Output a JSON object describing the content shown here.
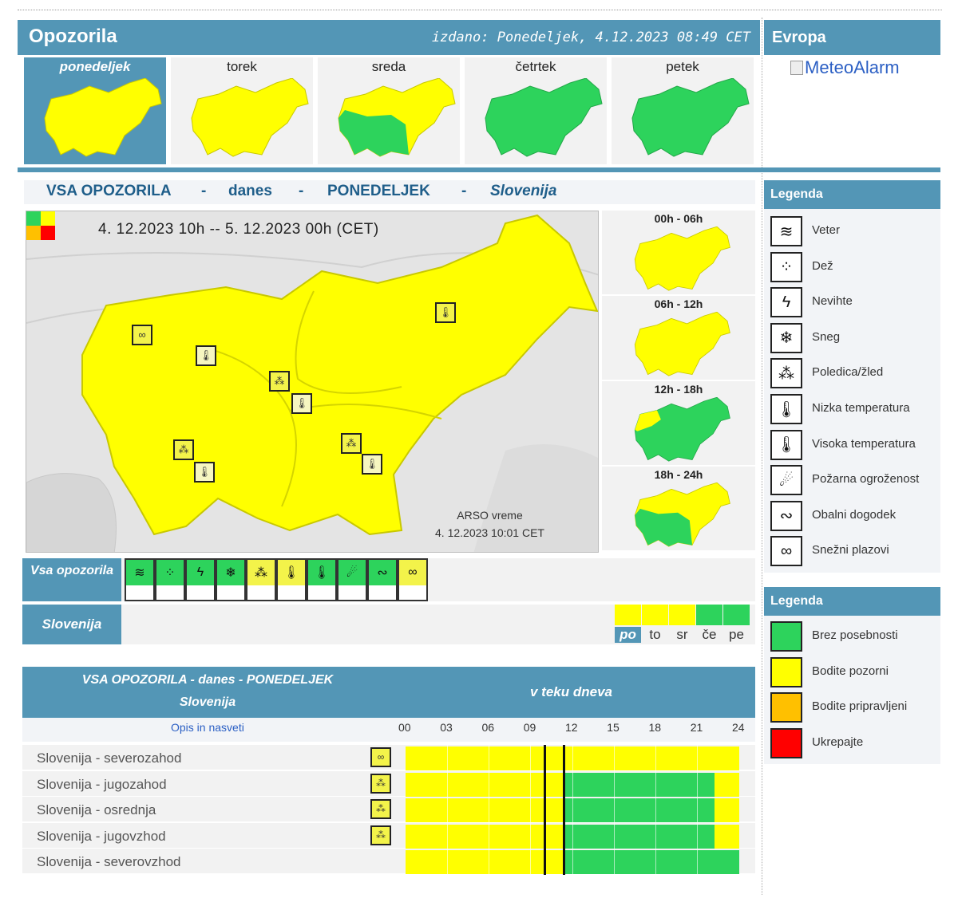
{
  "header": {
    "title": "Opozorila",
    "issued": "izdano: Ponedeljek, 4.12.2023 08:49 CET"
  },
  "europe": {
    "title": "Evropa",
    "meteoalarm_alt": "MeteoAlarm"
  },
  "days": [
    {
      "label": "ponedeljek",
      "active": true,
      "level": "yellow"
    },
    {
      "label": "torek",
      "active": false,
      "level": "yellow"
    },
    {
      "label": "sreda",
      "active": false,
      "level": "mixed"
    },
    {
      "label": "četrtek",
      "active": false,
      "level": "green"
    },
    {
      "label": "petek",
      "active": false,
      "level": "green"
    }
  ],
  "main_heading": {
    "part1": "VSA OPOZORILA",
    "sep1": "-",
    "part2": "danes",
    "sep2": "-",
    "part3": "PONEDELJEK",
    "sep3": "-",
    "part4": "Slovenija"
  },
  "map": {
    "date_range": "4. 12.2023  10h  --  5. 12.2023  00h     (CET)",
    "source": "ARSO vreme",
    "source_time": "4. 12.2023  10:01 CET"
  },
  "periods": [
    {
      "label": "00h - 06h",
      "level": "yellow"
    },
    {
      "label": "06h - 12h",
      "level": "yellow"
    },
    {
      "label": "12h - 18h",
      "level": "mostly-green"
    },
    {
      "label": "18h - 24h",
      "level": "mixed"
    }
  ],
  "categories_label": "Vsa opozorila",
  "categories": [
    {
      "icon": "wind-icon",
      "glyph": "≋",
      "color": "#2dd35c"
    },
    {
      "icon": "rain-icon",
      "glyph": "⁘",
      "color": "#2dd35c"
    },
    {
      "icon": "thunderstorm-icon",
      "glyph": "ϟ",
      "color": "#2dd35c"
    },
    {
      "icon": "snow-icon",
      "glyph": "❄",
      "color": "#2dd35c"
    },
    {
      "icon": "ice-icon",
      "glyph": "⁂",
      "color": "#f3f34a"
    },
    {
      "icon": "low-temperature-icon",
      "glyph": "🌡",
      "color": "#f3f34a"
    },
    {
      "icon": "high-temperature-icon",
      "glyph": "🌡",
      "color": "#2dd35c"
    },
    {
      "icon": "fire-danger-icon",
      "glyph": "☄",
      "color": "#2dd35c"
    },
    {
      "icon": "coastal-event-icon",
      "glyph": "∾",
      "color": "#2dd35c"
    },
    {
      "icon": "avalanche-icon",
      "glyph": "∞",
      "color": "#f3f34a"
    }
  ],
  "region_label": "Slovenija",
  "week": [
    {
      "label": "po",
      "color": "#ffff00",
      "active": true
    },
    {
      "label": "to",
      "color": "#ffff00",
      "active": false
    },
    {
      "label": "sr",
      "color": "#ffff00",
      "active": false
    },
    {
      "label": "če",
      "color": "#2dd35c",
      "active": false
    },
    {
      "label": "pe",
      "color": "#2dd35c",
      "active": false
    }
  ],
  "timeline": {
    "title1": "VSA OPOZORILA - danes - PONEDELJEK",
    "title2": "Slovenija",
    "title3": "v teku dneva",
    "opis": "Opis in nasveti",
    "hours": [
      "00",
      "03",
      "06",
      "09",
      "12",
      "15",
      "18",
      "21",
      "24"
    ],
    "rows": [
      {
        "name": "Slovenija - severozahod",
        "icon": "avalanche-icon",
        "glyph": "∞",
        "green_from": null,
        "green_to": null
      },
      {
        "name": "Slovenija - jugozahod",
        "icon": "ice-icon",
        "glyph": "⁂",
        "green_from": 11.5,
        "green_to": 22.2
      },
      {
        "name": "Slovenija - osrednja",
        "icon": "ice-icon",
        "glyph": "⁂",
        "green_from": 11.5,
        "green_to": 22.2
      },
      {
        "name": "Slovenija - jugovzhod",
        "icon": "ice-icon",
        "glyph": "⁂",
        "green_from": 11.5,
        "green_to": 22.2
      },
      {
        "name": "Slovenija - severovzhod",
        "icon": null,
        "glyph": "",
        "green_from": 11.5,
        "green_to": 24
      }
    ],
    "markers": [
      10,
      11.4
    ]
  },
  "legend1": {
    "title": "Legenda",
    "items": [
      {
        "icon": "wind-icon",
        "glyph": "≋",
        "label": "Veter"
      },
      {
        "icon": "rain-icon",
        "glyph": "⁘",
        "label": "Dež"
      },
      {
        "icon": "thunderstorm-icon",
        "glyph": "ϟ",
        "label": "Nevihte"
      },
      {
        "icon": "snow-icon",
        "glyph": "❄",
        "label": "Sneg"
      },
      {
        "icon": "ice-icon",
        "glyph": "⁂",
        "label": "Poledica/žled"
      },
      {
        "icon": "low-temperature-icon",
        "glyph": "🌡",
        "label": "Nizka temperatura"
      },
      {
        "icon": "high-temperature-icon",
        "glyph": "🌡",
        "label": "Visoka temperatura"
      },
      {
        "icon": "fire-danger-icon",
        "glyph": "☄",
        "label": "Požarna ogroženost"
      },
      {
        "icon": "coastal-event-icon",
        "glyph": "∾",
        "label": "Obalni dogodek"
      },
      {
        "icon": "avalanche-icon",
        "glyph": "∞",
        "label": "Snežni plazovi"
      }
    ]
  },
  "legend2": {
    "title": "Legenda",
    "items": [
      {
        "color": "#2dd35c",
        "label": "Brez posebnosti"
      },
      {
        "color": "#ffff00",
        "label": "Bodite pozorni"
      },
      {
        "color": "#ffc000",
        "label": "Bodite pripravljeni"
      },
      {
        "color": "#ff0000",
        "label": "Ukrepajte"
      }
    ]
  },
  "colors": {
    "accent": "#5396b6",
    "yellow": "#ffff00",
    "green": "#2dd35c",
    "orange": "#ffc000",
    "red": "#ff0000"
  }
}
